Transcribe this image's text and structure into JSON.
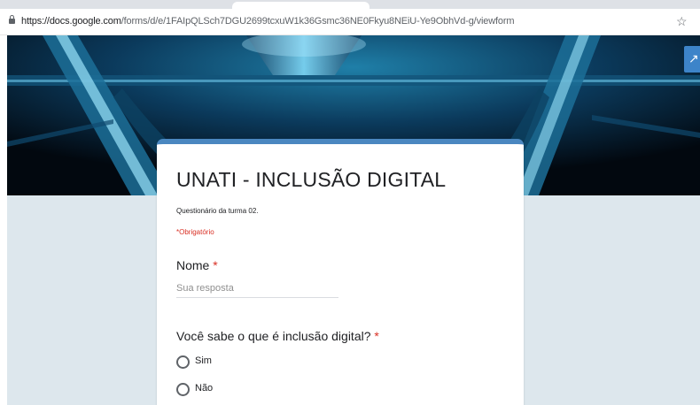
{
  "browser": {
    "url_domain": "https://docs.google.com",
    "url_path": "/forms/d/e/1FAIpQLSch7DGU2699tcxuW1k36Gsmc36NE0Fkyu8NEiU-Ye9ObhVd-g/viewform",
    "star_glyph": "☆",
    "ext_glyph": "⋮"
  },
  "form": {
    "title": "UNATI - INCLUSÃO DIGITAL",
    "description": "Questionário da turma 02.",
    "required_note": "*Obrigatório",
    "questions": [
      {
        "label": "Nome",
        "required_mark": "*",
        "placeholder": "Sua resposta"
      },
      {
        "label": "Você sabe o que é inclusão digital?",
        "required_mark": "*",
        "options": [
          "Sim",
          "Não"
        ]
      }
    ]
  },
  "colors": {
    "accent": "#4a87c0",
    "page_bg": "#dde7ed",
    "required": "#d93025"
  }
}
